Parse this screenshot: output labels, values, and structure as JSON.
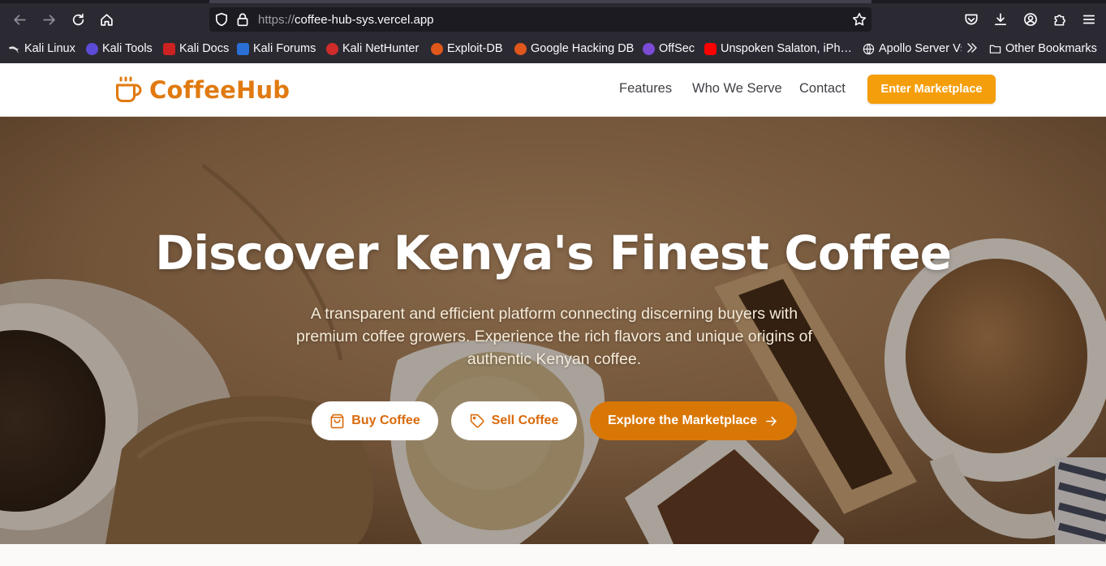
{
  "browser": {
    "url_scheme": "https://",
    "url_host": "coffee-hub-sys.vercel.app",
    "bookmarks": [
      {
        "label": "Kali Linux",
        "icon": "kali-dragon-icon",
        "color": "#1a1a1a"
      },
      {
        "label": "Kali Tools",
        "icon": "kali-tools-icon",
        "color": "#5b4bd6"
      },
      {
        "label": "Kali Docs",
        "icon": "kali-docs-icon",
        "color": "#cc2222"
      },
      {
        "label": "Kali Forums",
        "icon": "kali-forums-icon",
        "color": "#2a6fd6"
      },
      {
        "label": "Kali NetHunter",
        "icon": "nethunter-icon",
        "color": "#d02b2b"
      },
      {
        "label": "Exploit-DB",
        "icon": "exploit-db-icon",
        "color": "#e0571b"
      },
      {
        "label": "Google Hacking DB",
        "icon": "ghdb-icon",
        "color": "#e0571b"
      },
      {
        "label": "OffSec",
        "icon": "offsec-icon",
        "color": "#7b4bd6"
      },
      {
        "label": "Unspoken Salaton, iPh…",
        "icon": "youtube-icon",
        "color": "#ff0000"
      },
      {
        "label": "Apollo Server Vs",
        "icon": "globe-icon",
        "color": "#fbfbfe"
      }
    ],
    "other_bookmarks": "Other Bookmarks"
  },
  "site": {
    "brand": "CoffeeHub",
    "nav": {
      "features": "Features",
      "who_we_serve": "Who We Serve",
      "contact": "Contact"
    },
    "cta": "Enter Marketplace",
    "accent_color": "#e07a10"
  },
  "hero": {
    "title": "Discover Kenya's Finest Coffee",
    "subtitle": "A transparent and efficient platform connecting discerning buyers with premium coffee growers. Experience the rich flavors and unique origins of authentic Kenyan coffee.",
    "buy_label": "Buy Coffee",
    "sell_label": "Sell Coffee",
    "explore_label": "Explore the Marketplace"
  }
}
